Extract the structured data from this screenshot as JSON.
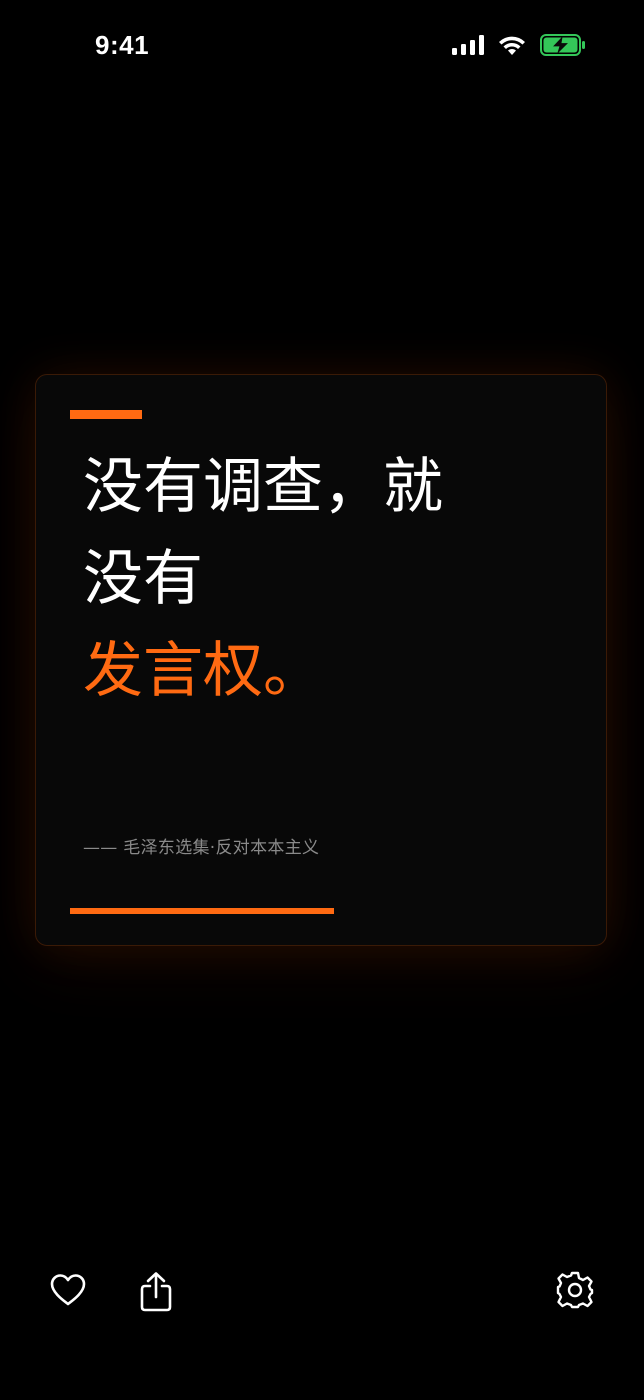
{
  "status_bar": {
    "time": "9:41",
    "icons": [
      "cellular-signal-icon",
      "wifi-icon",
      "battery-charging-icon"
    ],
    "battery_color": "#34c759"
  },
  "card": {
    "quote_lines": [
      "没有调查，就",
      "没有"
    ],
    "quote_highlight": "发言权。",
    "attribution": "—— 毛泽东选集·反对本本主义",
    "accent_color": "#ff6a12"
  },
  "toolbar": {
    "icons": [
      "heart-icon",
      "share-icon",
      "gear-icon"
    ]
  }
}
